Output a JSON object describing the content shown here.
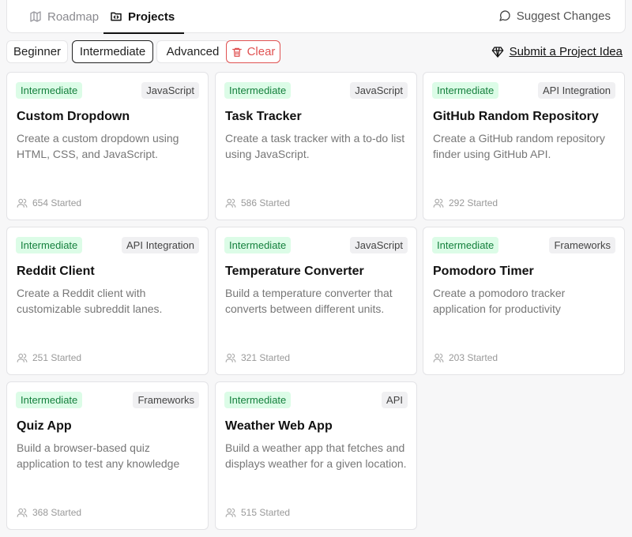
{
  "nav": {
    "tabs": [
      {
        "label": "Roadmap",
        "icon": "map-icon"
      },
      {
        "label": "Projects",
        "icon": "folder-code-icon",
        "active": true
      }
    ],
    "suggest_label": "Suggest Changes"
  },
  "filters": {
    "beginner": "Beginner",
    "intermediate": "Intermediate",
    "advanced": "Advanced",
    "clear": "Clear",
    "selected": "Intermediate",
    "submit_label": "Submit a Project Idea"
  },
  "colors": {
    "accent_green_bg": "#dcfce7",
    "accent_green_text": "#15803d",
    "clear_red": "#e05252"
  },
  "projects": [
    {
      "level": "Intermediate",
      "tag": "JavaScript",
      "title": "Custom Dropdown",
      "desc": "Create a custom dropdown using HTML, CSS, and JavaScript.",
      "started": "654 Started"
    },
    {
      "level": "Intermediate",
      "tag": "JavaScript",
      "title": "Task Tracker",
      "desc": "Create a task tracker with a to-do list using JavaScript.",
      "started": "586 Started"
    },
    {
      "level": "Intermediate",
      "tag": "API Integration",
      "title": "GitHub Random Repository",
      "desc": "Create a GitHub random repository finder using GitHub API.",
      "started": "292 Started"
    },
    {
      "level": "Intermediate",
      "tag": "API Integration",
      "title": "Reddit Client",
      "desc": "Create a Reddit client with customizable subreddit lanes.",
      "started": "251 Started"
    },
    {
      "level": "Intermediate",
      "tag": "JavaScript",
      "title": "Temperature Converter",
      "desc": "Build a temperature converter that converts between different units.",
      "started": "321 Started"
    },
    {
      "level": "Intermediate",
      "tag": "Frameworks",
      "title": "Pomodoro Timer",
      "desc": "Create a pomodoro tracker application for productivity",
      "started": "203 Started"
    },
    {
      "level": "Intermediate",
      "tag": "Frameworks",
      "title": "Quiz App",
      "desc": "Build a browser-based quiz application to test any knowledge",
      "started": "368 Started"
    },
    {
      "level": "Intermediate",
      "tag": "API",
      "title": "Weather Web App",
      "desc": "Build a weather app that fetches and displays weather for a given location.",
      "started": "515 Started"
    }
  ]
}
